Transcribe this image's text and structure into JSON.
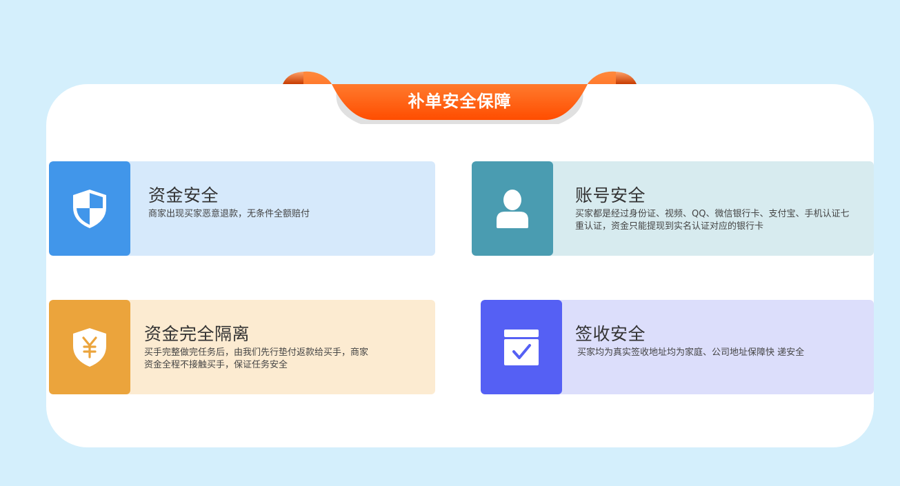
{
  "header": {
    "title": "补单安全保障"
  },
  "cards": [
    {
      "title": "资金安全",
      "desc": "商家出现买家恶意退款，无条件全额赔付",
      "icon": "shield-icon"
    },
    {
      "title": "账号安全",
      "desc_line1": "买家都是经过身份证、视频、QQ、微信银行卡、支付宝、手机认证七",
      "desc_line2": "重认证，资金只能提现到实名认证对应的银行卡",
      "icon": "user-icon"
    },
    {
      "title": "资金完全隔离",
      "desc_line1": "买手完整做完任务后，由我们先行垫付返款给买手，商家",
      "desc_line2": "资金全程不接触买手，保证任务安全",
      "icon": "yuan-shield-icon"
    },
    {
      "title": "签收安全",
      "desc": "买家均为真实签收地址均为家庭、公司地址保障快 递安全",
      "icon": "check-box-icon"
    }
  ],
  "colors": {
    "page_bg": "#d4effc",
    "ribbon": "#ff5a0a",
    "card1_icon": "#4196ea",
    "card2_icon": "#4a9cb1",
    "card3_icon": "#eba43c",
    "card4_icon": "#5560f4"
  }
}
